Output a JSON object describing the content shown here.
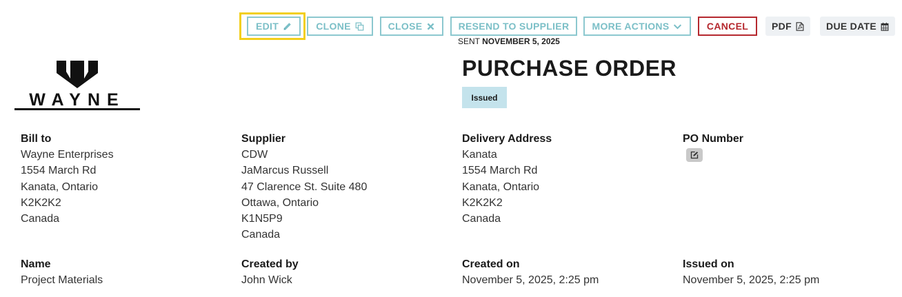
{
  "toolbar": {
    "edit_label": "EDIT",
    "clone_label": "CLONE",
    "close_label": "CLOSE",
    "resend_label": "RESEND TO SUPPLIER",
    "more_actions_label": "MORE ACTIONS",
    "cancel_label": "CANCEL",
    "pdf_label": "PDF",
    "due_date_label": "DUE DATE"
  },
  "sent": {
    "prefix": "SENT",
    "date": "NOVEMBER 5, 2025"
  },
  "logo": {
    "text": "WAYNE"
  },
  "document": {
    "title": "PURCHASE ORDER",
    "status": "Issued"
  },
  "bill_to": {
    "heading": "Bill to",
    "lines": [
      "Wayne Enterprises",
      "1554 March Rd",
      "Kanata, Ontario",
      "K2K2K2",
      "Canada"
    ]
  },
  "supplier": {
    "heading": "Supplier",
    "lines": [
      "CDW",
      "JaMarcus Russell",
      "47 Clarence St. Suite 480",
      "Ottawa, Ontario",
      "K1N5P9",
      "Canada"
    ]
  },
  "delivery": {
    "heading": "Delivery Address",
    "lines": [
      "Kanata",
      "1554 March Rd",
      "Kanata, Ontario",
      "K2K2K2",
      "Canada"
    ]
  },
  "po_number": {
    "heading": "PO Number"
  },
  "details": {
    "name_heading": "Name",
    "name_value": "Project Materials",
    "created_by_heading": "Created by",
    "created_by_value": "John Wick",
    "created_on_heading": "Created on",
    "created_on_value": "November 5, 2025, 2:25 pm",
    "issued_on_heading": "Issued on",
    "issued_on_value": "November 5, 2025, 2:25 pm"
  },
  "colors": {
    "accent": "#7bbfc7",
    "cancel": "#b5282e",
    "highlight": "#f2cf1a",
    "status_bg": "#c4e3ec"
  },
  "icons": [
    "pencil-icon",
    "copy-icon",
    "x-icon",
    "chevron-down-icon",
    "file-pdf-icon",
    "calendar-icon",
    "edit-square-icon"
  ]
}
